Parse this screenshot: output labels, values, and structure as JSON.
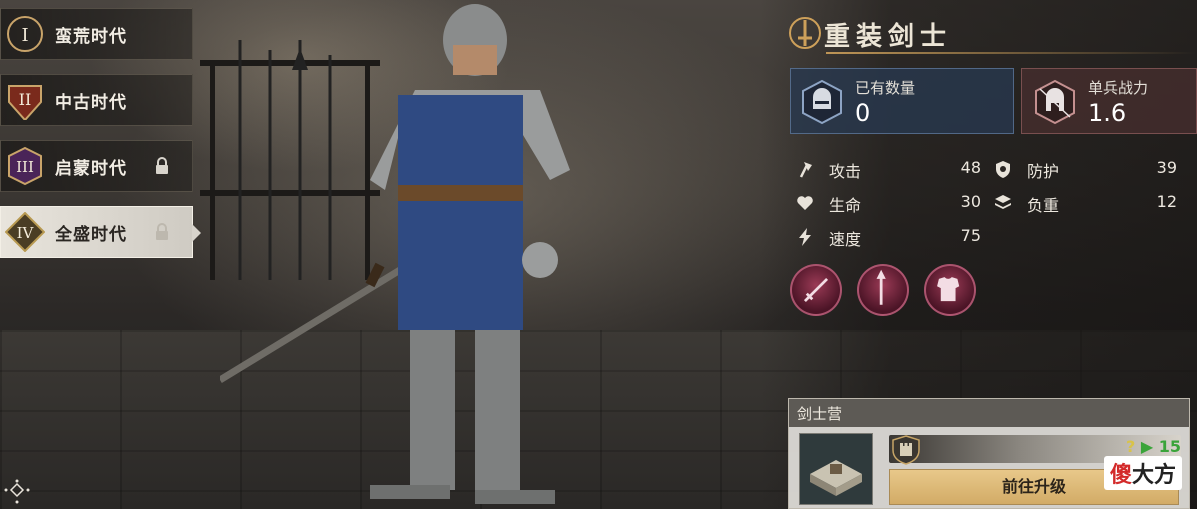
{
  "eras": [
    {
      "numeral": "I",
      "label": "蛮荒时代",
      "locked": false,
      "active": false,
      "color": "#c9a46a"
    },
    {
      "numeral": "II",
      "label": "中古时代",
      "locked": false,
      "active": false,
      "color": "#a8452c"
    },
    {
      "numeral": "III",
      "label": "启蒙时代",
      "locked": true,
      "active": false,
      "color": "#6a3a7a"
    },
    {
      "numeral": "IV",
      "label": "全盛时代",
      "locked": true,
      "active": true,
      "color": "#b89a52"
    }
  ],
  "unit": {
    "title": "重装剑士",
    "owned_label": "已有数量",
    "owned_value": "0",
    "power_label": "单兵战力",
    "power_value": "1.6"
  },
  "attributes": [
    {
      "name": "攻击",
      "value": "48",
      "icon": "axe-icon"
    },
    {
      "name": "防护",
      "value": "39",
      "icon": "shield-icon"
    },
    {
      "name": "生命",
      "value": "30",
      "icon": "heart-icon"
    },
    {
      "name": "负重",
      "value": "12",
      "icon": "stack-icon"
    },
    {
      "name": "速度",
      "value": "75",
      "icon": "lightning-icon"
    }
  ],
  "skills": [
    "sword-skill-icon",
    "spear-skill-icon",
    "armor-skill-icon"
  ],
  "barracks": {
    "title": "剑士营",
    "level_current": "?",
    "level_next": "15",
    "button_label": "前往升级"
  },
  "watermark": {
    "red": "傻",
    "black": "大方"
  },
  "colors": {
    "accent_gold": "#cda05a",
    "count_card": "#283850",
    "power_card": "#462e2e",
    "skill": "#9a3a55",
    "level_green": "#3aa43a"
  }
}
